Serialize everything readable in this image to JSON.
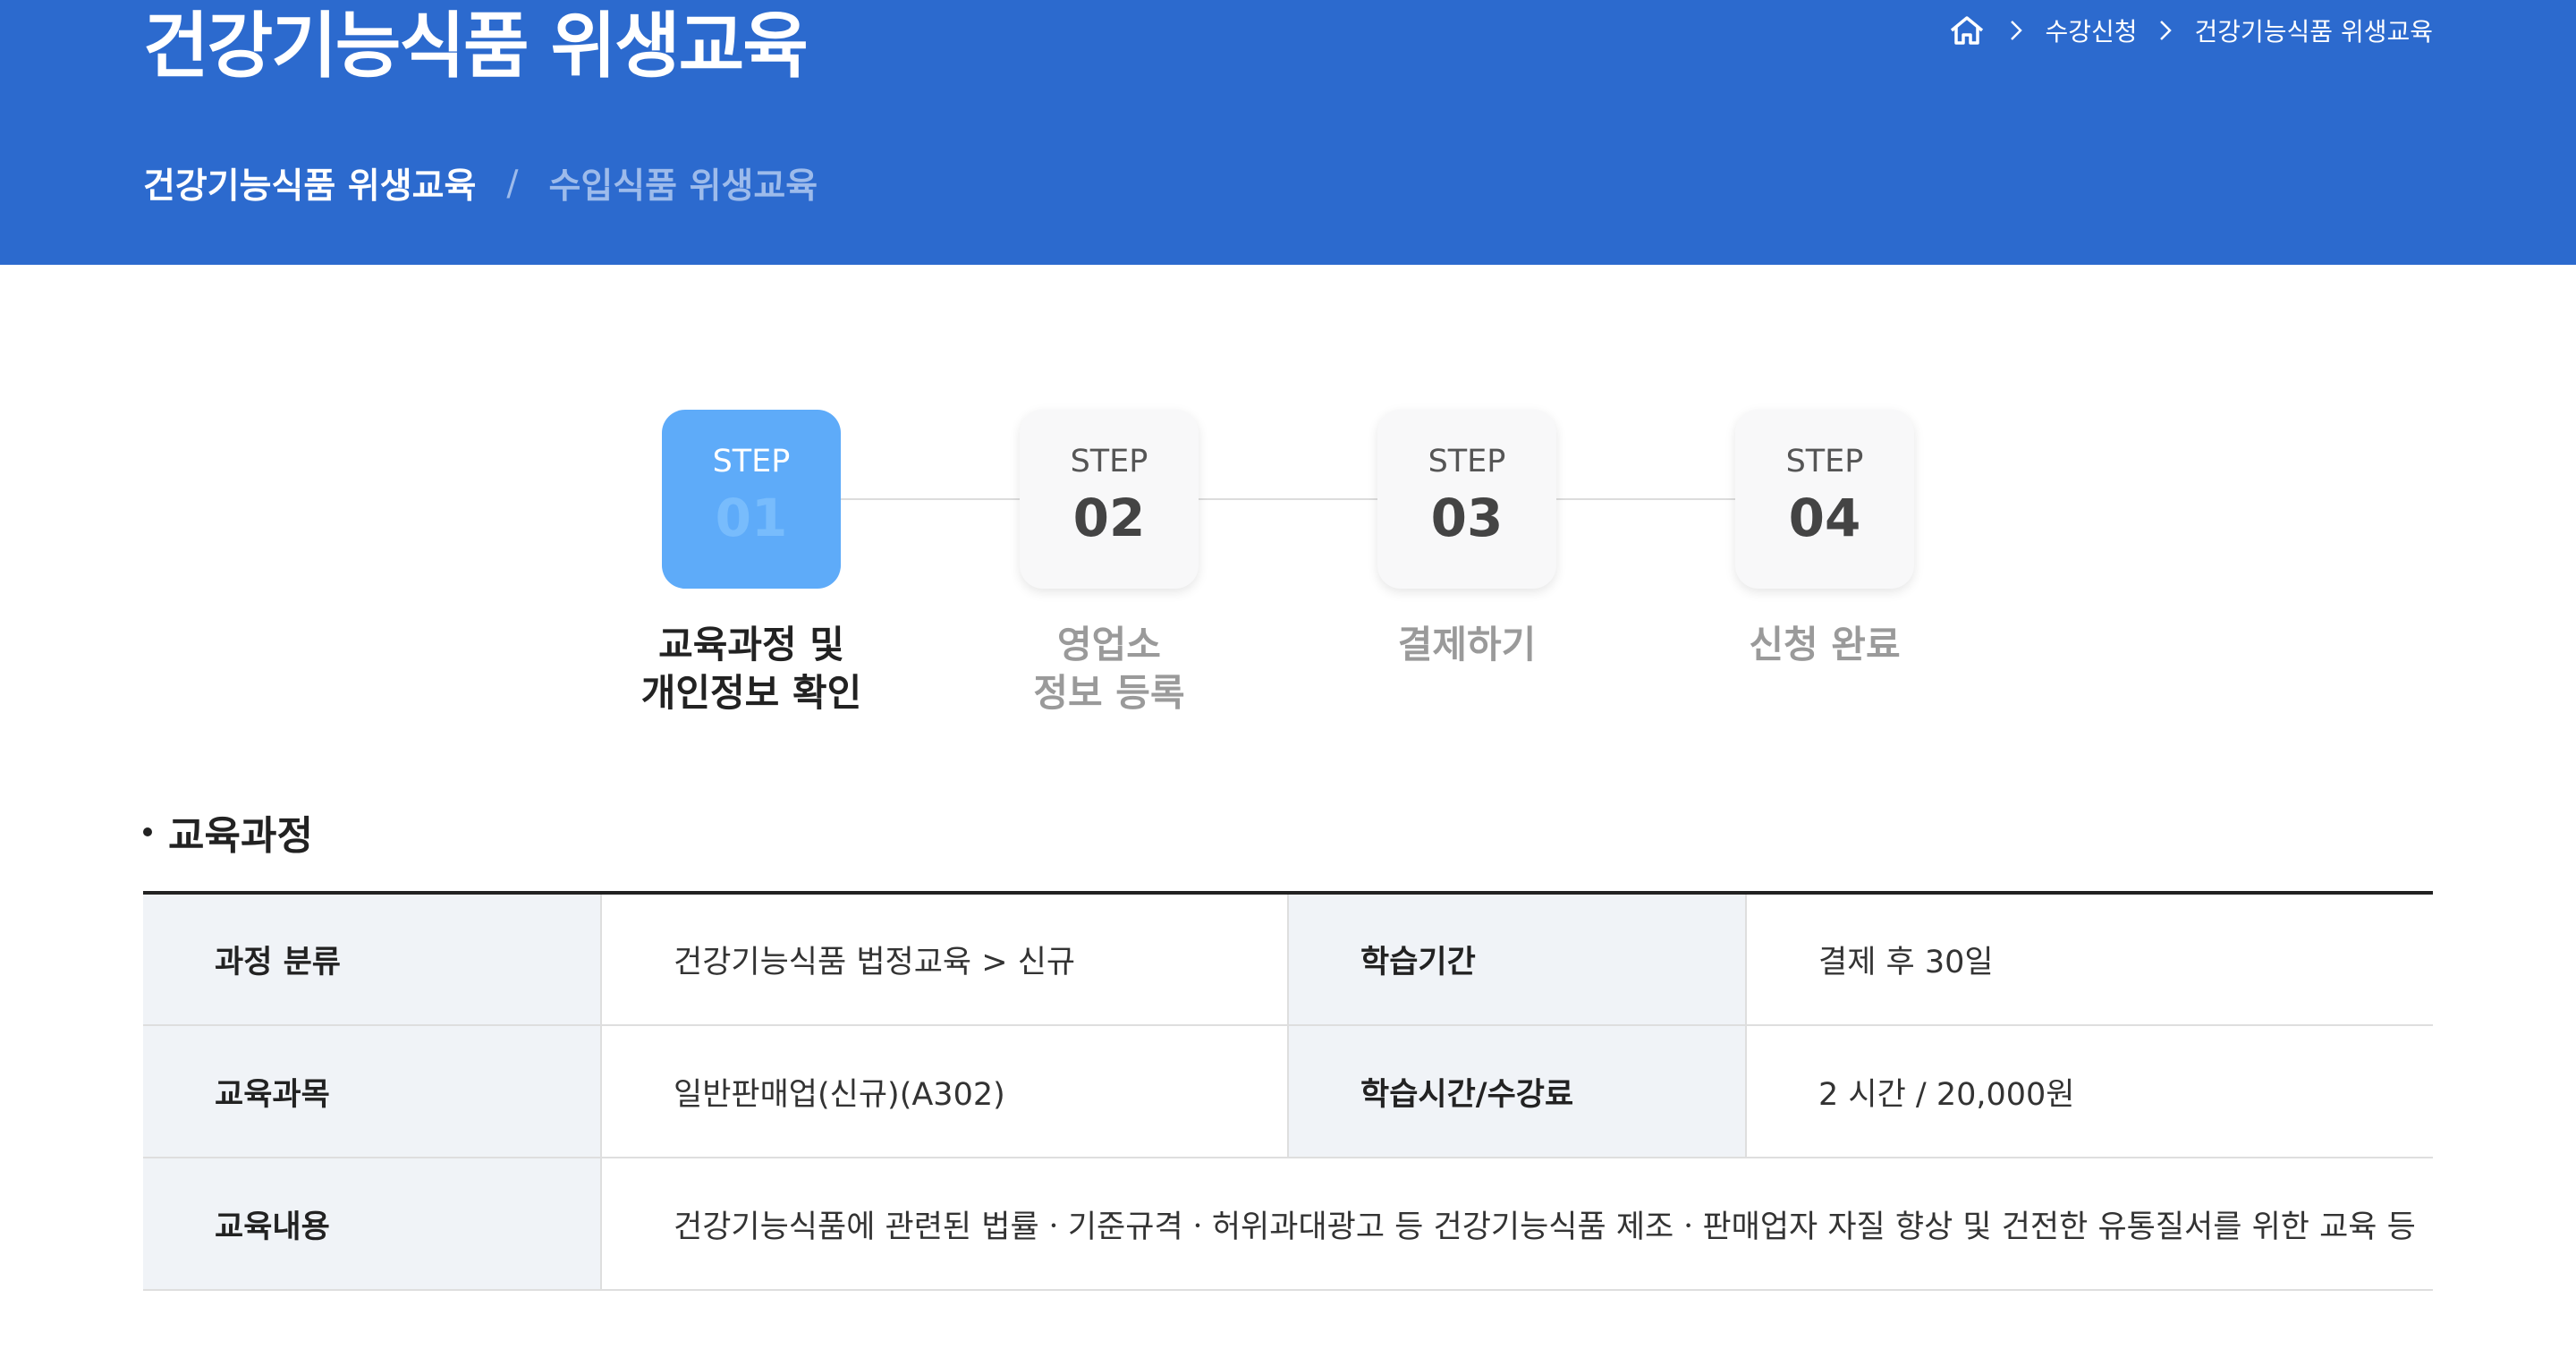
{
  "header": {
    "title": "건강기능식품 위생교육",
    "breadcrumb": {
      "home_icon": "home-icon",
      "items": [
        "수강신청",
        "건강기능식품 위생교육"
      ]
    },
    "subnav": {
      "active": "건강기능식품 위생교육",
      "separator": "/",
      "inactive": "수입식품 위생교육"
    },
    "colors": {
      "background": "#2c6ace",
      "inactive_text": "#9dbbeb"
    }
  },
  "steps": [
    {
      "keyword": "STEP",
      "number": "01",
      "caption_line1": "교육과정 및",
      "caption_line2": "개인정보 확인",
      "active": true
    },
    {
      "keyword": "STEP",
      "number": "02",
      "caption_line1": "영업소",
      "caption_line2": "정보 등록",
      "active": false
    },
    {
      "keyword": "STEP",
      "number": "03",
      "caption_line1": "결제하기",
      "caption_line2": "",
      "active": false
    },
    {
      "keyword": "STEP",
      "number": "04",
      "caption_line1": "신청 완료",
      "caption_line2": "",
      "active": false
    }
  ],
  "section": {
    "title": "교육과정"
  },
  "table": {
    "rows": [
      {
        "label1": "과정 분류",
        "value1": "건강기능식품 법정교육 > 신규",
        "label2": "학습기간",
        "value2": "결제 후 30일"
      },
      {
        "label1": "교육과목",
        "value1": "일반판매업(신규)(A302)",
        "label2": "학습시간/수강료",
        "value2": "2 시간 / 20,000원"
      },
      {
        "label1": "교육내용",
        "value1": "건강기능식품에 관련된 법률ㆍ기준규격ㆍ허위과대광고 등 건강기능식품 제조ㆍ판매업자 자질 향상 및 건전한 유통질서를 위한 교육 등"
      }
    ]
  }
}
